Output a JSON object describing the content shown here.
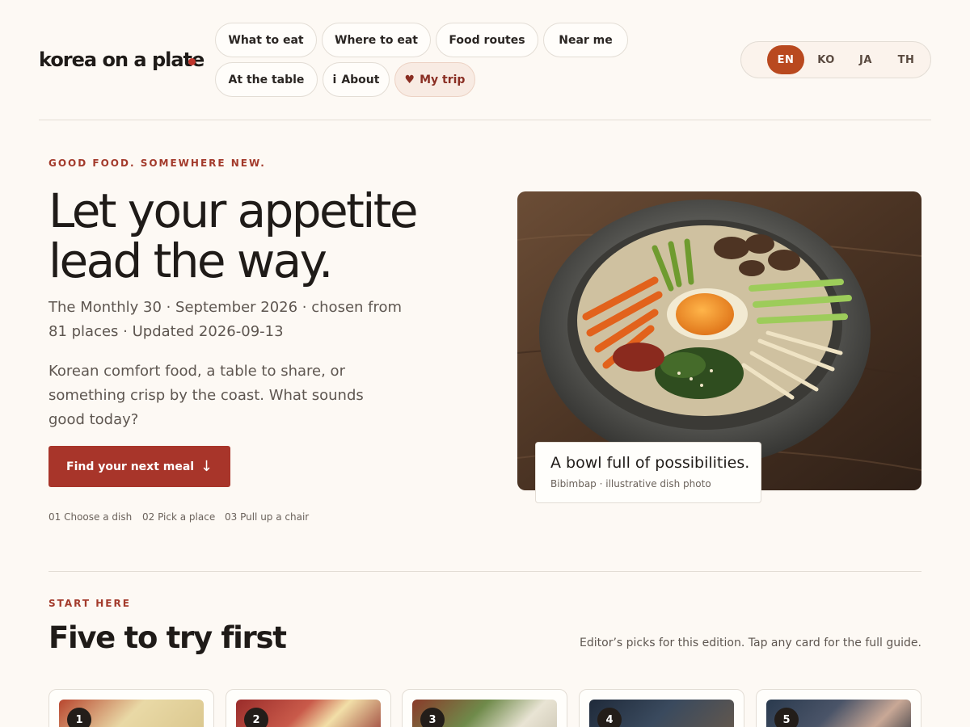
{
  "header": {
    "brand": "korea on a plate",
    "nav": [
      {
        "label": "What to eat"
      },
      {
        "label": "Where to eat"
      },
      {
        "label": "Food routes"
      },
      {
        "label": "Near me"
      },
      {
        "label": "At the table"
      },
      {
        "label": "About",
        "icon": "info-icon"
      },
      {
        "label": "My trip",
        "icon": "heart-icon",
        "active": true
      }
    ],
    "languages": [
      "EN",
      "KO",
      "JA",
      "TH"
    ],
    "selected_language": "EN"
  },
  "hero": {
    "eyebrow": "GOOD FOOD. SOMEWHERE NEW.",
    "headline": "Let your appetite lead the way.",
    "meta": "The Monthly 30 · September 2026 · chosen from 81 places · Updated 2026-09-13",
    "lede": "Korean comfort food, a table to share, or something crisp by the coast. What sounds good today?",
    "cta_label": "Find your next meal",
    "steps": [
      "01 Choose a dish",
      "02 Pick a place",
      "03 Pull up a chair"
    ],
    "photo_caption_title": "A bowl full of possibilities.",
    "photo_caption_sub": "Bibimbap · illustrative dish photo"
  },
  "picks": {
    "eyebrow": "START HERE",
    "title": "Five to try first",
    "note": "Editor’s picks for this edition. Tap any card for the full guide.",
    "cards": [
      {
        "number": "1"
      },
      {
        "number": "2"
      },
      {
        "number": "3"
      },
      {
        "number": "4"
      },
      {
        "number": "5"
      }
    ]
  },
  "colors": {
    "accent": "#a8352a",
    "language_active": "#b9491f",
    "background": "#fdf9f4"
  }
}
